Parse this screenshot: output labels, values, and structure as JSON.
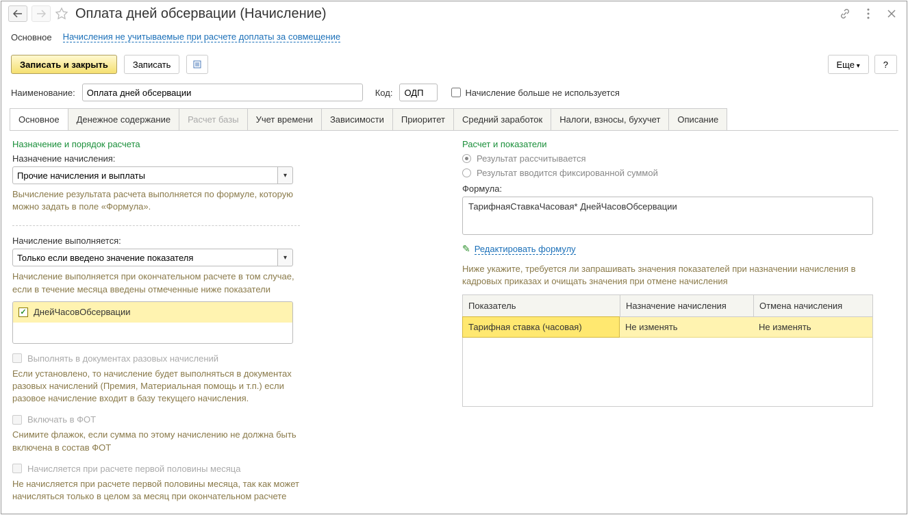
{
  "title": "Оплата дней обсервации (Начисление)",
  "subnav": {
    "main": "Основное",
    "link": "Начисления не учитываемые при расчете доплаты за совмещение"
  },
  "toolbar": {
    "save_close": "Записать и закрыть",
    "save": "Записать",
    "more": "Еще",
    "help": "?"
  },
  "form": {
    "name_label": "Наименование:",
    "name_value": "Оплата дней обсервации",
    "code_label": "Код:",
    "code_value": "ОДП",
    "not_used_label": "Начисление больше не используется"
  },
  "tabs": [
    "Основное",
    "Денежное содержание",
    "Расчет базы",
    "Учет времени",
    "Зависимости",
    "Приоритет",
    "Средний заработок",
    "Налоги, взносы, бухучет",
    "Описание"
  ],
  "left": {
    "section1": "Назначение и порядок расчета",
    "purpose_label": "Назначение начисления:",
    "purpose_value": "Прочие начисления и выплаты",
    "purpose_hint": "Вычисление результата расчета выполняется по формуле, которую можно задать в поле «Формула».",
    "executed_label": "Начисление выполняется:",
    "executed_value": "Только если введено значение показателя",
    "executed_hint": "Начисление выполняется при окончательном расчете в том случае, если в течение месяца введены отмеченные ниже показатели",
    "indicator": "ДнейЧасовОбсервации",
    "cb1": "Выполнять в документах разовых начислений",
    "cb1_hint": "Если установлено, то начисление будет выполняться в документах разовых начислений (Премия, Материальная помощь и т.п.) если разовое начисление входит в базу текущего начисления.",
    "cb2": "Включать в ФОТ",
    "cb2_hint": "Снимите флажок, если сумма по этому начислению не должна быть включена в состав ФОТ",
    "cb3": "Начисляется при расчете первой половины месяца",
    "cb3_hint": "Не начисляется при расчете первой половины месяца, так как может начисляться только в целом за месяц при окончательном расчете"
  },
  "right": {
    "section": "Расчет и показатели",
    "radio1": "Результат рассчитывается",
    "radio2": "Результат вводится фиксированной суммой",
    "formula_label": "Формула:",
    "formula_value": "ТарифнаяСтавкаЧасовая* ДнейЧасовОбсервации",
    "edit_link": "Редактировать формулу",
    "table_hint": "Ниже укажите, требуется ли запрашивать значения показателей при назначении начисления в кадровых приказах и очищать значения при отмене начисления",
    "th1": "Показатель",
    "th2": "Назначение начисления",
    "th3": "Отмена начисления",
    "row": {
      "c1": "Тарифная ставка (часовая)",
      "c2": "Не изменять",
      "c3": "Не изменять"
    }
  }
}
